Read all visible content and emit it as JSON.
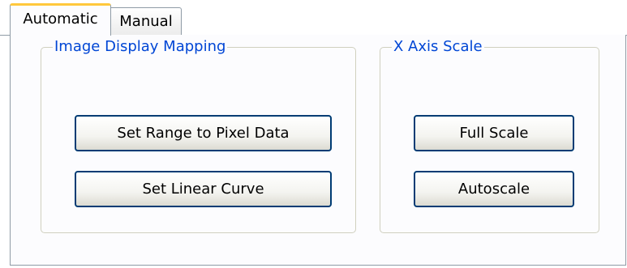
{
  "tabs": [
    {
      "label": "Automatic",
      "selected": true
    },
    {
      "label": "Manual",
      "selected": false
    }
  ],
  "image_display_mapping": {
    "title": "Image Display Mapping",
    "set_range_label": "Set Range to Pixel Data",
    "set_linear_label": "Set Linear Curve"
  },
  "x_axis_scale": {
    "title": "X Axis Scale",
    "full_scale_label": "Full Scale",
    "autoscale_label": "Autoscale"
  },
  "colors": {
    "group_title": "#0046d5",
    "selected_tab_highlight": "#ffc83c",
    "button_border": "#003c74"
  }
}
